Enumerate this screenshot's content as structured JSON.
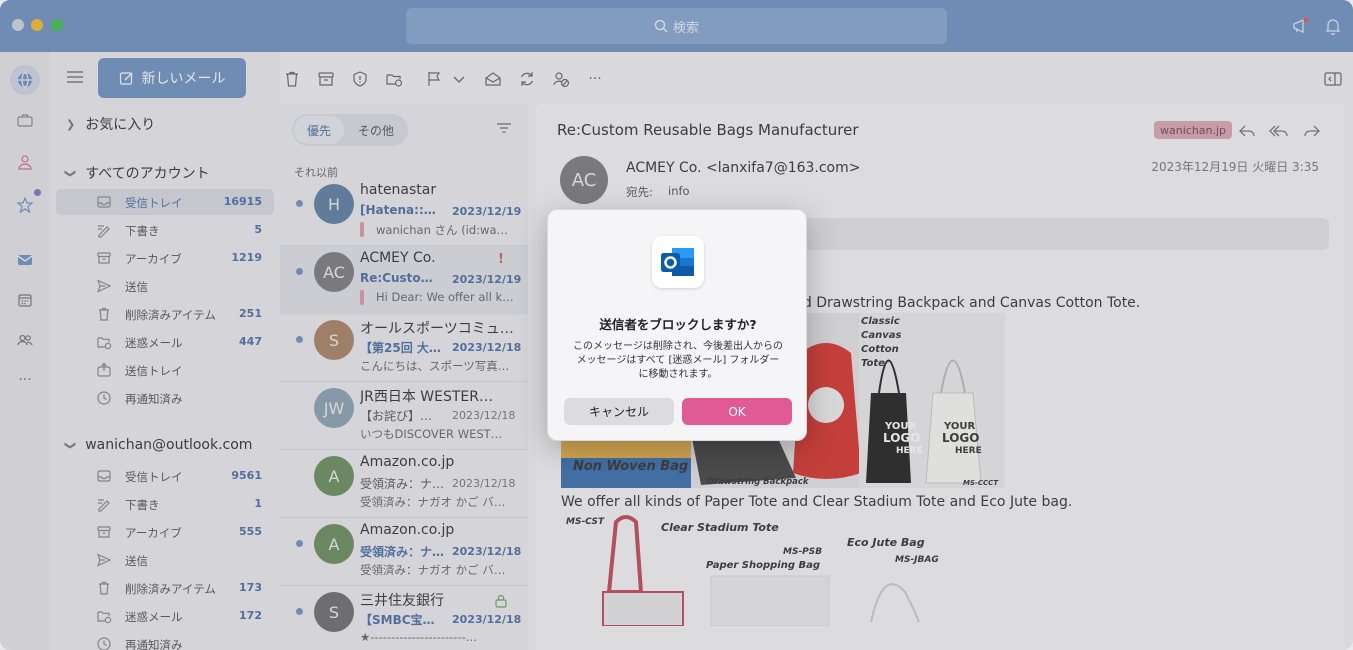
{
  "titlebar": {
    "search_placeholder": "検索"
  },
  "folder_pane": {
    "new_mail_label": "新しいメール",
    "favorites_label": "お気に入り",
    "all_accounts_label": "すべてのアカウント",
    "all_accounts_folders": [
      {
        "label": "受信トレイ",
        "count": "16915",
        "icon": "inbox-icon"
      },
      {
        "label": "下書き",
        "count": "5",
        "icon": "draft-icon"
      },
      {
        "label": "アーカイブ",
        "count": "1219",
        "icon": "archive-icon"
      },
      {
        "label": "送信",
        "count": "",
        "icon": "send-icon"
      },
      {
        "label": "削除済みアイテム",
        "count": "251",
        "icon": "trash-icon"
      },
      {
        "label": "迷惑メール",
        "count": "447",
        "icon": "junk-icon"
      },
      {
        "label": "送信トレイ",
        "count": "",
        "icon": "outbox-icon"
      },
      {
        "label": "再通知済み",
        "count": "",
        "icon": "clock-icon"
      }
    ],
    "account_label": "wanichan@outlook.com",
    "account_folders": [
      {
        "label": "受信トレイ",
        "count": "9561",
        "icon": "inbox-icon"
      },
      {
        "label": "下書き",
        "count": "1",
        "icon": "draft-icon"
      },
      {
        "label": "アーカイブ",
        "count": "555",
        "icon": "archive-icon"
      },
      {
        "label": "送信",
        "count": "",
        "icon": "send-icon"
      },
      {
        "label": "削除済みアイテム",
        "count": "173",
        "icon": "trash-icon"
      },
      {
        "label": "迷惑メール",
        "count": "172",
        "icon": "junk-icon"
      },
      {
        "label": "再通知済み",
        "count": "",
        "icon": "clock-icon"
      }
    ]
  },
  "message_list": {
    "tab_focused": "優先",
    "tab_other": "その他",
    "group_label": "それ以前",
    "messages": [
      {
        "initials": "H",
        "avatar_color": "#5f7fa3",
        "sender": "hatenastar",
        "subject": "[Hatena::S]...",
        "date": "2023/12/19",
        "preview": "wanichan さん (id:wani...",
        "unread": true,
        "flag": false,
        "preview_bar": true
      },
      {
        "initials": "AC",
        "avatar_color": "#7d7d80",
        "sender": "ACMEY Co.",
        "subject": "Re:Custom...",
        "date": "2023/12/19",
        "preview": "Hi Dear: We offer all ki...",
        "unread": true,
        "flag": true,
        "preview_bar": true
      },
      {
        "initials": "S",
        "avatar_color": "#a88464",
        "sender": "オールスポーツコミュ…",
        "subject": "【第25回 大…",
        "date": "2023/12/18",
        "preview": "こんにちは、スポーツ写真…",
        "unread": true,
        "flag": false,
        "preview_bar": false
      },
      {
        "initials": "JW",
        "avatar_color": "#8aa3b5",
        "sender": "JR西日本 WESTER…",
        "subject": "【お詫び】メー…",
        "date": "2023/12/18",
        "preview": "いつもDISCOVER WEST…",
        "unread": false,
        "flag": false,
        "preview_bar": false
      },
      {
        "initials": "A",
        "avatar_color": "#6a8f5e",
        "sender": "Amazon.co.jp",
        "subject": "受領済み：ナ…",
        "date": "2023/12/18",
        "preview": "受領済み：ナガオ かご バス…",
        "unread": false,
        "flag": false,
        "preview_bar": false
      },
      {
        "initials": "A",
        "avatar_color": "#6a8f5e",
        "sender": "Amazon.co.jp",
        "subject": "受領済み：ナ…",
        "date": "2023/12/18",
        "preview": "受領済み：ナガオ かご バス…",
        "unread": true,
        "flag": false,
        "preview_bar": false
      },
      {
        "initials": "S",
        "avatar_color": "#6e6e72",
        "sender": "三井住友銀行",
        "subject": "【SMBC宝く…",
        "date": "2023/12/18",
        "preview": "★-----------------------...",
        "unread": true,
        "flag": false,
        "preview_bar": false
      }
    ]
  },
  "reading_pane": {
    "subject": "Re:Custom Reusable Bags Manufacturer",
    "tag": "wanichan.jp",
    "avatar_initials": "AC",
    "from": "ACMEY Co. <lanxifa7@163.com>",
    "to_label": "宛先:",
    "to": "info",
    "date": "2023年12月19日 火曜日 3:35",
    "body_line1": "nd Drawstring Backpack and Canvas Cotton Tote.",
    "body_line2": "We offer all kinds of Paper Tote and Clear Stadium Tote and Eco Jute bag.",
    "img1_labels": {
      "non_woven": "Non Woven Bag",
      "drawstring": "Drawstring Backpack",
      "canvas": [
        "Classic",
        "Canvas",
        "Cotton",
        "Tote"
      ],
      "logo1": [
        "YOUR",
        "LOGO",
        "HERE"
      ],
      "logo2": [
        "YOUR",
        "LOGO",
        "HERE"
      ],
      "code": "MS-CCCT"
    },
    "img2_labels": {
      "code1": "MS-CST",
      "clear": "Clear Stadium Tote",
      "code2": "MS-PSB",
      "paper": "Paper Shopping Bag",
      "eco": "Eco Jute Bag",
      "code3": "MS-JBAG"
    }
  },
  "dialog": {
    "title": "送信者をブロックしますか?",
    "message_lines": [
      "このメッセージは削除され、今後差出人からの",
      "メッセージはすべて [迷惑メール] フォルダー",
      "に移動されます。"
    ],
    "cancel_label": "キャンセル",
    "ok_label": "OK"
  }
}
